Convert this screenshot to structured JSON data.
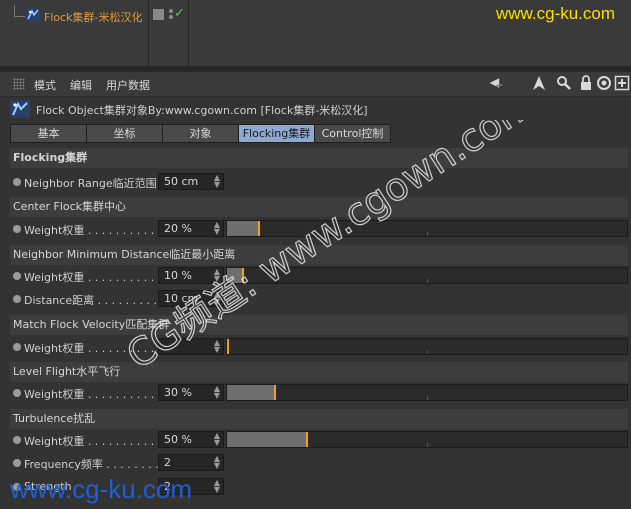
{
  "object_manager": {
    "object_name": "Flock集群-米松汉化",
    "watermark": "www.cg-ku.com"
  },
  "menubar": {
    "items": [
      "模式",
      "编辑",
      "用户数据"
    ],
    "tool_icons": [
      "arrow-left-icon",
      "cursor-icon",
      "search-icon",
      "lock-icon",
      "target-icon",
      "new-panel-icon"
    ]
  },
  "title": "Flock Object集群对象By:www.cgown.com [Flock集群-米松汉化]",
  "tabs": [
    {
      "label": "基本",
      "active": false
    },
    {
      "label": "坐标",
      "active": false
    },
    {
      "label": "对象",
      "active": false
    },
    {
      "label": "Flocking集群",
      "active": true
    },
    {
      "label": "Control控制",
      "active": false
    }
  ],
  "sections": {
    "flocking": {
      "title": "Flocking集群",
      "neighbor_range": {
        "label": "Neighbor Range临近范围",
        "value": "50 cm"
      }
    },
    "center_flock": {
      "title": "Center Flock集群中心",
      "weight": {
        "label": "Weight权重 . . . . . . . . . . .",
        "value": "20 %",
        "level": 0.2
      }
    },
    "neighbor_min": {
      "title": "Neighbor Minimum Distance临近最小距离",
      "weight": {
        "label": "Weight权重 . . . . . . . . . . .",
        "value": "10 %",
        "level": 0.1
      },
      "distance": {
        "label": "Distance距离 . . . . . . . . . .",
        "value": "10 cm"
      }
    },
    "match_velocity": {
      "title": "Match Flock Velocity匹配集群",
      "weight": {
        "label": "Weight权重 . . . . . . . . . . .",
        "value": "",
        "level": 0.0
      }
    },
    "level_flight": {
      "title": "Level Flight水平飞行",
      "weight": {
        "label": "Weight权重 . . . . . . . . . . .",
        "value": "30 %",
        "level": 0.3
      }
    },
    "turbulence": {
      "title": "Turbulence扰乱",
      "weight": {
        "label": "Weight权重 . . . . . . . . . . .",
        "value": "50 %",
        "level": 0.5
      },
      "frequency": {
        "label": "Frequency频率 . . . . . . . .",
        "value": "2"
      },
      "strength": {
        "label": "Strength",
        "value": "2"
      }
    }
  },
  "overlay": {
    "diagonal_watermark": "CG频道: www.cgown.com",
    "bottom_watermark": "www.cg-ku.com"
  },
  "colors": {
    "accent_orange": "#f0a020",
    "active_tab": "#8da9d2",
    "object_name": "#e09a3a",
    "watermark_yellow": "#ffde00",
    "watermark_blue": "#1e5fd8"
  }
}
